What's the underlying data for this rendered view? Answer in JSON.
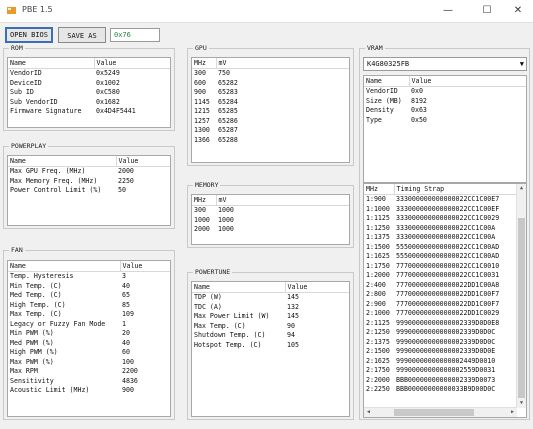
{
  "window": {
    "title": "PBE 1.5",
    "minimize": "—",
    "maximize": "☐",
    "close": "✕"
  },
  "toolbar": {
    "open_label": "OPEN BIOS",
    "save_label": "SAVE AS",
    "checksum": "0x76"
  },
  "rom": {
    "group": "ROM",
    "headers": [
      "Name",
      "Value"
    ],
    "rows": [
      [
        "VendorID",
        "0x5249"
      ],
      [
        "DeviceID",
        "0x1002"
      ],
      [
        "Sub ID",
        "0xC580"
      ],
      [
        "Sub VendorID",
        "0x1682"
      ],
      [
        "Firmware Signature",
        "0x4D4F5441"
      ]
    ]
  },
  "powerplay": {
    "group": "POWERPLAY",
    "headers": [
      "Name",
      "Value"
    ],
    "rows": [
      [
        "Max GPU Freq. (MHz)",
        "2000"
      ],
      [
        "Max Memory Freq. (MHz)",
        "2250"
      ],
      [
        "Power Control Limit (%)",
        "50"
      ]
    ]
  },
  "fan": {
    "group": "FAN",
    "headers": [
      "Name",
      "Value"
    ],
    "rows": [
      [
        "Temp. Hysteresis",
        "3"
      ],
      [
        "Min Temp. (C)",
        "40"
      ],
      [
        "Med Temp. (C)",
        "65"
      ],
      [
        "High Temp. (C)",
        "85"
      ],
      [
        "Max Temp. (C)",
        "109"
      ],
      [
        "Legacy or Fuzzy Fan Mode",
        "1"
      ],
      [
        "Min PWM (%)",
        "20"
      ],
      [
        "Med PWM (%)",
        "40"
      ],
      [
        "High PWM (%)",
        "60"
      ],
      [
        "Max PWM (%)",
        "100"
      ],
      [
        "Max RPM",
        "2200"
      ],
      [
        "Sensitivity",
        "4836"
      ],
      [
        "Acoustic Limit (MHz)",
        "900"
      ]
    ]
  },
  "gpu": {
    "group": "GPU",
    "headers": [
      "MHz",
      "mV"
    ],
    "rows": [
      [
        "300",
        "750"
      ],
      [
        "600",
        "65282"
      ],
      [
        "900",
        "65283"
      ],
      [
        "1145",
        "65284"
      ],
      [
        "1215",
        "65285"
      ],
      [
        "1257",
        "65286"
      ],
      [
        "1300",
        "65287"
      ],
      [
        "1366",
        "65288"
      ]
    ]
  },
  "memory": {
    "group": "MEMORY",
    "headers": [
      "MHz",
      "mV"
    ],
    "rows": [
      [
        "300",
        "1000"
      ],
      [
        "1000",
        "1000"
      ],
      [
        "2000",
        "1000"
      ]
    ]
  },
  "powertune": {
    "group": "POWERTUNE",
    "headers": [
      "Name",
      "Value"
    ],
    "rows": [
      [
        "TDP (W)",
        "145"
      ],
      [
        "TDC (A)",
        "132"
      ],
      [
        "Max Power Limit (W)",
        "145"
      ],
      [
        "Max Temp. (C)",
        "90"
      ],
      [
        "Shutdown Temp. (C)",
        "94"
      ],
      [
        "Hotspot Temp. (C)",
        "105"
      ]
    ]
  },
  "vram": {
    "group": "VRAM",
    "selected": "K4G80325FB",
    "headers": [
      "Name",
      "Value"
    ],
    "rows": [
      [
        "VendorID",
        "0x0"
      ],
      [
        "Size (MB)",
        "8192"
      ],
      [
        "Density",
        "0x63"
      ],
      [
        "Type",
        "0x50"
      ]
    ]
  },
  "timings": {
    "headers": [
      "MHz",
      "Timing Strap"
    ],
    "rows": [
      [
        "1:900",
        "333000000000000022CC1C00E7"
      ],
      [
        "1:1000",
        "333000000000000022CC1C00EF"
      ],
      [
        "1:1125",
        "333000000000000022CC1C0029"
      ],
      [
        "1:1250",
        "333000000000000022CC1C00A"
      ],
      [
        "1:1375",
        "333000000000000022CC1C00A"
      ],
      [
        "1:1500",
        "555000000000000022CC1C00AD"
      ],
      [
        "1:1625",
        "555000000000000022CC1C00AD"
      ],
      [
        "1:1750",
        "777000000000000022CC1C0010"
      ],
      [
        "1:2000",
        "777000000000000022CC1C0031"
      ],
      [
        "2:400",
        "777000000000000022DD1C00A8"
      ],
      [
        "2:800",
        "777000000000000022DD1C00F7"
      ],
      [
        "2:900",
        "777000000000000022DD1C00F7"
      ],
      [
        "2:1000",
        "777000000000000022DD1C0029"
      ],
      [
        "2:1125",
        "99900000000000002339D0D0E8"
      ],
      [
        "2:1250",
        "99900000000000002339D0D0C"
      ],
      [
        "2:1375",
        "99900000000000002339D0D0C"
      ],
      [
        "2:1500",
        "99900000000000002339D0D0E"
      ],
      [
        "2:1625",
        "99900000000000002449D0010"
      ],
      [
        "2:1750",
        "99900000000000002559D0031"
      ],
      [
        "2:2000",
        "BBB00000000000002339D0073"
      ],
      [
        "2:2250",
        "BBB00000000000033B9D00D0C"
      ]
    ]
  },
  "colors": {
    "accent": "#3a6fb5",
    "checksum_text": "#1a8a3a",
    "icon": "#e89a2c"
  }
}
